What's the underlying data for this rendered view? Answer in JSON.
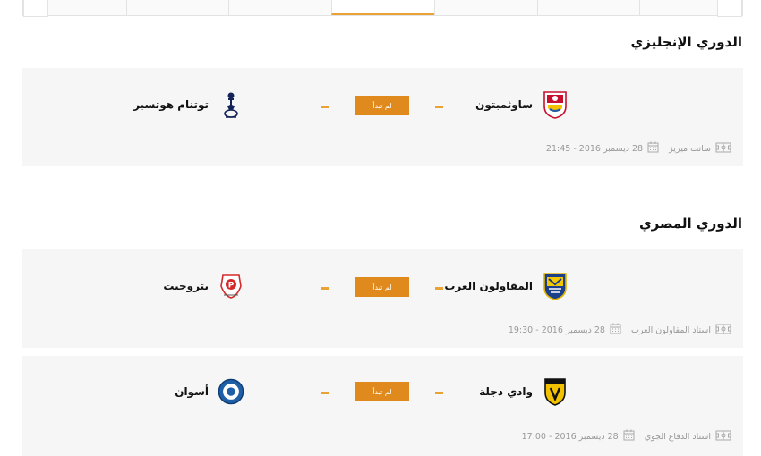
{
  "tabs": {
    "items": [
      "",
      "",
      "",
      "",
      "",
      "",
      ""
    ],
    "active_index": 3
  },
  "leagues": [
    {
      "title": "الدوري الإنجليزي",
      "matches": [
        {
          "home": "ساوثمبتون",
          "away": "توتنام هوتسبر",
          "status": "لم تبدأ",
          "venue": "سانت ميريز",
          "date": "28 ديسمبر 2016 - 21:45"
        }
      ]
    },
    {
      "title": "الدوري المصري",
      "matches": [
        {
          "home": "المقاولون العرب",
          "away": "بتروجيت",
          "status": "لم تبدأ",
          "venue": "استاد المقاولون العرب",
          "date": "28 ديسمبر 2016 - 19:30"
        },
        {
          "home": "وادي دجلة",
          "away": "أسوان",
          "status": "لم تبدأ",
          "venue": "استاد الدفاع الجوي",
          "date": "28 ديسمبر 2016 - 17:00"
        }
      ]
    }
  ],
  "icons": {
    "stadium": "stadium-icon",
    "calendar": "calendar-icon",
    "prev": "chevron-left-icon",
    "next": "chevron-right-icon"
  },
  "colors": {
    "accent": "#e8a236",
    "status_bg": "#e08a1e",
    "card_bg": "#f6f6f6"
  }
}
